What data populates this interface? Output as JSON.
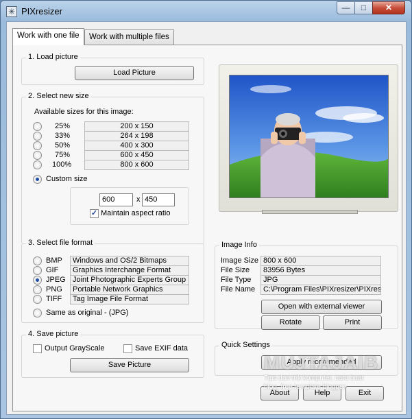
{
  "window": {
    "title": "PIXresizer"
  },
  "tabs": [
    {
      "label": "Work with one file",
      "active": true
    },
    {
      "label": "Work with multiple files",
      "active": false
    }
  ],
  "load": {
    "group_label": "1. Load picture",
    "button": "Load Picture"
  },
  "size": {
    "group_label": "2. Select new size",
    "caption": "Available sizes for this image:",
    "options": [
      {
        "pct": "25%",
        "dims": "200 x 150",
        "checked": false
      },
      {
        "pct": "33%",
        "dims": "264 x 198",
        "checked": false
      },
      {
        "pct": "50%",
        "dims": "400 x 300",
        "checked": false
      },
      {
        "pct": "75%",
        "dims": "600 x 450",
        "checked": false
      },
      {
        "pct": "100%",
        "dims": "800 x 600",
        "checked": false
      }
    ],
    "custom_label": "Custom size",
    "custom_checked": true,
    "width": "600",
    "height": "450",
    "x_sep": "x",
    "aspect_label": "Maintain aspect ratio",
    "aspect_checked": true
  },
  "format": {
    "group_label": "3. Select file format",
    "options": [
      {
        "ext": "BMP",
        "desc": "Windows and OS/2 Bitmaps",
        "checked": false
      },
      {
        "ext": "GIF",
        "desc": "Graphics Interchange Format",
        "checked": false
      },
      {
        "ext": "JPEG",
        "desc": "Joint Photographic Experts Group",
        "checked": true
      },
      {
        "ext": "PNG",
        "desc": "Portable Network Graphics",
        "checked": false
      },
      {
        "ext": "TIFF",
        "desc": "Tag Image File Format",
        "checked": false
      }
    ],
    "same_label": "Same as original  - (JPG)"
  },
  "save": {
    "group_label": "4. Save picture",
    "grayscale_label": "Output GrayScale",
    "exif_label": "Save EXIF data",
    "button": "Save Picture"
  },
  "image_info": {
    "group_label": "Image Info",
    "rows": [
      {
        "label": "Image Size",
        "value": "800 x 600"
      },
      {
        "label": "File Size",
        "value": "83956 Bytes"
      },
      {
        "label": "File Type",
        "value": "JPG"
      },
      {
        "label": "File Name",
        "value": "C:\\Program Files\\PIXresizer\\PIXresiz"
      }
    ],
    "open_button": "Open with external viewer",
    "rotate_button": "Rotate",
    "print_button": "Print"
  },
  "quick": {
    "group_label": "Quick Settings",
    "button": "Apply recommended"
  },
  "bottom": {
    "about": "About",
    "help": "Help",
    "exit": "Exit"
  },
  "watermark": {
    "brand": "MUJTAJAIB",
    "line1": "Tips dan trik komputer, cara buat",
    "line2": "blog, free template blogger"
  },
  "colors": {
    "accent": "#1f4fa8",
    "titlebar": "#bcd3ea",
    "close": "#c74f3b"
  }
}
